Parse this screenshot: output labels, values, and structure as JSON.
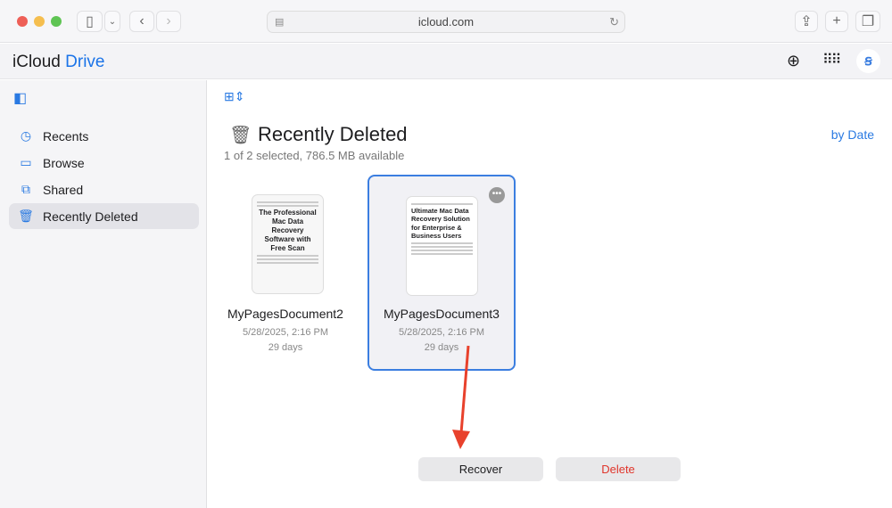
{
  "browser": {
    "url": "icloud.com"
  },
  "app": {
    "brand": "iCloud",
    "product": "Drive"
  },
  "sidebar": {
    "items": [
      {
        "label": "Recents"
      },
      {
        "label": "Browse"
      },
      {
        "label": "Shared"
      },
      {
        "label": "Recently Deleted"
      }
    ]
  },
  "main": {
    "title": "Recently Deleted",
    "subtitle": "1 of 2 selected, 786.5 MB available",
    "sort": "by Date",
    "files": [
      {
        "name": "MyPagesDocument2",
        "date": "5/28/2025, 2:16 PM",
        "remaining": "29 days",
        "preview": "The Professional Mac Data Recovery Software with Free Scan",
        "selected": false
      },
      {
        "name": "MyPagesDocument3",
        "date": "5/28/2025, 2:16 PM",
        "remaining": "29 days",
        "preview": "Ultimate Mac Data Recovery Solution for Enterprise & Business Users",
        "selected": true
      }
    ]
  },
  "actions": {
    "recover": "Recover",
    "delete": "Delete"
  },
  "colors": {
    "accent": "#2a7ae2",
    "delete": "#e0352b",
    "arrow": "#e8412c"
  }
}
